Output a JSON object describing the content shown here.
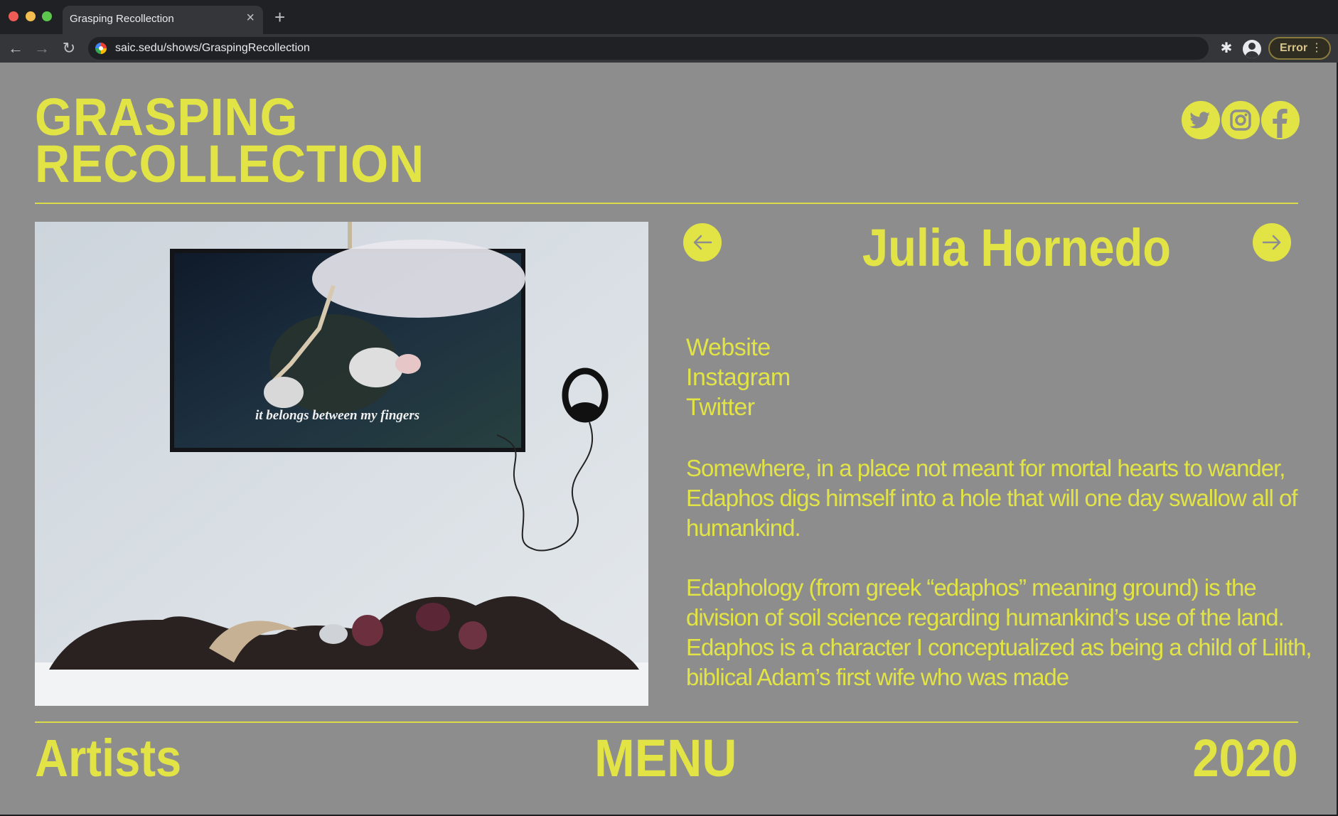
{
  "browser": {
    "tab_title": "Grasping Recollection",
    "tab_close": "×",
    "new_tab": "+",
    "url": "saic.sedu/shows/GraspingRecollection",
    "back": "←",
    "forward": "→",
    "reload": "↻",
    "extensions": "✱",
    "error_label": "Error",
    "error_menu": "⋮"
  },
  "site": {
    "title_line1": "GRASPING",
    "title_line2": "RECOLLECTION",
    "accent_color": "#e2e446",
    "background_color": "#8d8d8e",
    "socials": [
      "twitter-icon",
      "instagram-icon",
      "facebook-icon"
    ]
  },
  "artist": {
    "name": "Julia Hornedo",
    "links": [
      "Website",
      "Instagram",
      "Twitter"
    ],
    "bio": [
      "Somewhere, in a place not meant for mortal hearts to wander, Edaphos digs himself into a hole that will one day swallow all of humankind.",
      "Edaphology (from greek “edaphos” meaning ground) is the division of soil science regarding humankind’s use of the land. Edaphos is a character I conceptualized as being a child of Lilith, biblical Adam’s first wife who was made"
    ],
    "image_caption": "it belongs between my fingers"
  },
  "footer": {
    "artists": "Artists",
    "menu": "MENU",
    "year": "2020"
  }
}
